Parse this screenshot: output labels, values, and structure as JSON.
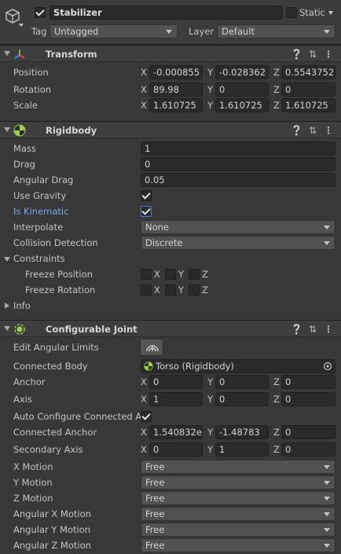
{
  "object": {
    "name": "Stabilizer",
    "static_label": "Static",
    "tag_label": "Tag",
    "tag_value": "Untagged",
    "layer_label": "Layer",
    "layer_value": "Default"
  },
  "transform": {
    "title": "Transform",
    "rows": [
      {
        "label": "Position",
        "x": "-0.000855",
        "y": "-0.028362",
        "z": "0.5543752"
      },
      {
        "label": "Rotation",
        "x": "89.98",
        "y": "0",
        "z": "0"
      },
      {
        "label": "Scale",
        "x": "1.610725",
        "y": "1.610725",
        "z": "1.610725"
      }
    ]
  },
  "rigidbody": {
    "title": "Rigidbody",
    "mass_label": "Mass",
    "mass": "1",
    "drag_label": "Drag",
    "drag": "0",
    "angular_drag_label": "Angular Drag",
    "angular_drag": "0.05",
    "use_gravity_label": "Use Gravity",
    "is_kinematic_label": "Is Kinematic",
    "interpolate_label": "Interpolate",
    "interpolate": "None",
    "collision_label": "Collision Detection",
    "collision": "Discrete",
    "constraints_label": "Constraints",
    "freeze_position_label": "Freeze Position",
    "freeze_rotation_label": "Freeze Rotation",
    "info_label": "Info"
  },
  "axes": {
    "x": "X",
    "y": "Y",
    "z": "Z"
  },
  "joint": {
    "title": "Configurable Joint",
    "edit_limits_label": "Edit Angular Limits",
    "connected_body_label": "Connected Body",
    "connected_body": "Torso (Rigidbody)",
    "anchor_label": "Anchor",
    "anchor": {
      "x": "0",
      "y": "0",
      "z": "0"
    },
    "axis_label": "Axis",
    "axis": {
      "x": "1",
      "y": "0",
      "z": "0"
    },
    "auto_config_label": "Auto Configure Connected A",
    "connected_anchor_label": "Connected Anchor",
    "connected_anchor": {
      "x": "1.540832e",
      "y": "-1.48783",
      "z": "0"
    },
    "secondary_axis_label": "Secondary Axis",
    "secondary_axis": {
      "x": "0",
      "y": "1",
      "z": "0"
    },
    "motions": [
      {
        "label": "X Motion",
        "value": "Free"
      },
      {
        "label": "Y Motion",
        "value": "Free"
      },
      {
        "label": "Z Motion",
        "value": "Free"
      },
      {
        "label": "Angular X Motion",
        "value": "Free"
      },
      {
        "label": "Angular Y Motion",
        "value": "Free"
      },
      {
        "label": "Angular Z Motion",
        "value": "Free"
      }
    ]
  }
}
